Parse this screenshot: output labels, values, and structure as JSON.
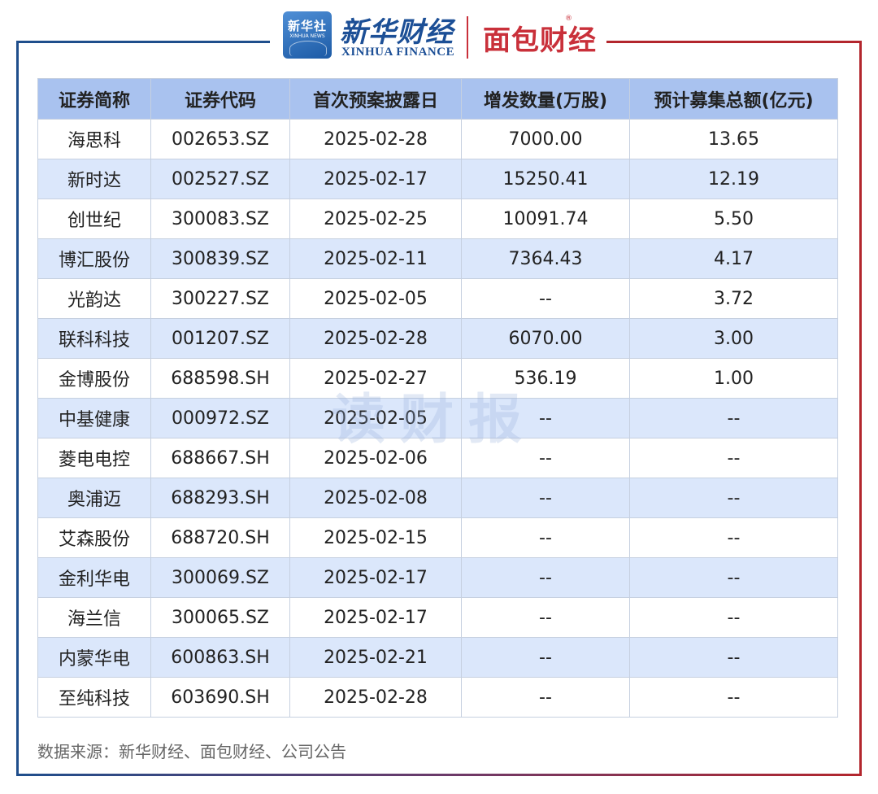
{
  "header": {
    "xinhuashe_text": "新华社",
    "xinhuashe_sub": "XINHUA NEWS",
    "xinhua_finance_name": "新华财经",
    "xinhua_finance_sub": "XINHUA FINANCE",
    "mianbao_name": "面包财经",
    "registered_mark": "®"
  },
  "watermark": "读财报",
  "table": {
    "headers": [
      "证券简称",
      "证券代码",
      "首次预案披露日",
      "增发数量(万股)",
      "预计募集总额(亿元)"
    ],
    "rows": [
      [
        "海思科",
        "002653.SZ",
        "2025-02-28",
        "7000.00",
        "13.65"
      ],
      [
        "新时达",
        "002527.SZ",
        "2025-02-17",
        "15250.41",
        "12.19"
      ],
      [
        "创世纪",
        "300083.SZ",
        "2025-02-25",
        "10091.74",
        "5.50"
      ],
      [
        "博汇股份",
        "300839.SZ",
        "2025-02-11",
        "7364.43",
        "4.17"
      ],
      [
        "光韵达",
        "300227.SZ",
        "2025-02-05",
        "--",
        "3.72"
      ],
      [
        "联科科技",
        "001207.SZ",
        "2025-02-28",
        "6070.00",
        "3.00"
      ],
      [
        "金博股份",
        "688598.SH",
        "2025-02-27",
        "536.19",
        "1.00"
      ],
      [
        "中基健康",
        "000972.SZ",
        "2025-02-05",
        "--",
        "--"
      ],
      [
        "菱电电控",
        "688667.SH",
        "2025-02-06",
        "--",
        "--"
      ],
      [
        "奥浦迈",
        "688293.SH",
        "2025-02-08",
        "--",
        "--"
      ],
      [
        "艾森股份",
        "688720.SH",
        "2025-02-15",
        "--",
        "--"
      ],
      [
        "金利华电",
        "300069.SZ",
        "2025-02-17",
        "--",
        "--"
      ],
      [
        "海兰信",
        "300065.SZ",
        "2025-02-17",
        "--",
        "--"
      ],
      [
        "内蒙华电",
        "600863.SH",
        "2025-02-21",
        "--",
        "--"
      ],
      [
        "至纯科技",
        "603690.SH",
        "2025-02-28",
        "--",
        "--"
      ]
    ]
  },
  "source": "数据来源：新华财经、面包财经、公司公告",
  "colors": {
    "header_bg": "#a9c2ef",
    "stripe_bg": "#dbe7fb",
    "frame_blue": "#1f4e8c",
    "frame_red": "#b3262d"
  }
}
